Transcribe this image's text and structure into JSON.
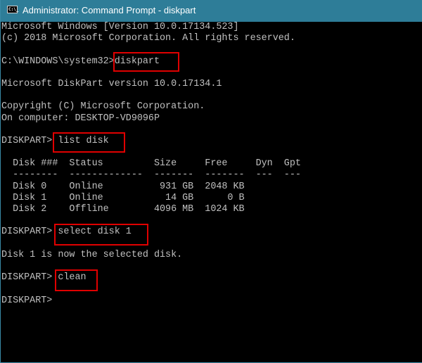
{
  "window": {
    "title": "Administrator: Command Prompt - diskpart",
    "icon": "cmd-icon",
    "icon_text": "C:\\_",
    "titlebar_color": "#2e7d98",
    "highlight_color": "#e00000"
  },
  "console": {
    "lines": [
      "Microsoft Windows [Version 10.0.17134.523]",
      "(c) 2018 Microsoft Corporation. All rights reserved.",
      "",
      "C:\\WINDOWS\\system32>diskpart",
      "",
      "Microsoft DiskPart version 10.0.17134.1",
      "",
      "Copyright (C) Microsoft Corporation.",
      "On computer: DESKTOP-VD9096P",
      "",
      "DISKPART> list disk",
      "",
      "  Disk ###  Status         Size     Free     Dyn  Gpt",
      "  --------  -------------  -------  -------  ---  ---",
      "  Disk 0    Online          931 GB  2048 KB",
      "  Disk 1    Online           14 GB      0 B",
      "  Disk 2    Offline        4096 MB  1024 KB",
      "",
      "DISKPART> select disk 1",
      "",
      "Disk 1 is now the selected disk.",
      "",
      "DISKPART> clean",
      "",
      "DISKPART> "
    ],
    "highlighted_commands": [
      "diskpart",
      "list disk",
      "select disk 1",
      "clean"
    ]
  },
  "disk_table": {
    "columns": [
      "Disk ###",
      "Status",
      "Size",
      "Free",
      "Dyn",
      "Gpt"
    ],
    "rows": [
      {
        "disk": "Disk 0",
        "status": "Online",
        "size": "931 GB",
        "free": "2048 KB",
        "dyn": "",
        "gpt": ""
      },
      {
        "disk": "Disk 1",
        "status": "Online",
        "size": "14 GB",
        "free": "0 B",
        "dyn": "",
        "gpt": ""
      },
      {
        "disk": "Disk 2",
        "status": "Offline",
        "size": "4096 MB",
        "free": "1024 KB",
        "dyn": "",
        "gpt": ""
      }
    ]
  }
}
